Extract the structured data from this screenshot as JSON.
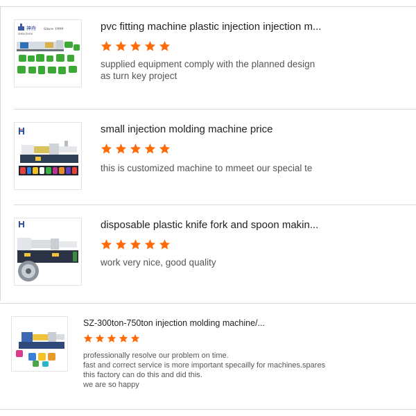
{
  "colors": {
    "star": "#ff6b08",
    "divider": "#d9d9d9"
  },
  "reviews": [
    {
      "title": "pvc fitting machine plastic injection injection m...",
      "rating": 5,
      "text": [
        "supplied equipment comply with the planned design",
        "as turn key project"
      ],
      "thumb": {
        "brand": "神舟",
        "brand_sub": "SHEN ZHOU",
        "since": "Since 1999"
      }
    },
    {
      "title": "small injection molding machine price",
      "rating": 5,
      "text": [
        "this is customized machine to mmeet our special te"
      ]
    },
    {
      "title": "disposable plastic knife fork and spoon makin...",
      "rating": 5,
      "text": [
        "work very nice, good quality"
      ]
    },
    {
      "title": "SZ-300ton-750ton injection molding machine/...",
      "rating": 5,
      "text": [
        "professionally resolve our problem on time.",
        "fast and correct service is more important specailly for machines.spares",
        "this factory can do this and did this.",
        "we are so happy"
      ]
    }
  ]
}
